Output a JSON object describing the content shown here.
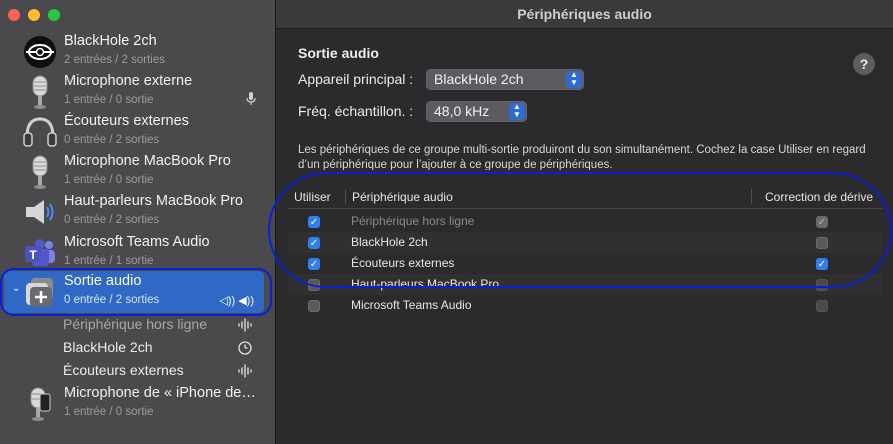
{
  "window": {
    "title": "Périphériques audio"
  },
  "sidebar": {
    "devices": [
      {
        "name": "BlackHole 2ch",
        "sub": "2 entrées / 2 sorties",
        "icon": "blackhole-icon"
      },
      {
        "name": "Microphone externe",
        "sub": "1 entrée / 0 sortie",
        "icon": "microphone-icon",
        "badge": "microphone-badge-icon"
      },
      {
        "name": "Écouteurs externes",
        "sub": "0 entrée / 2 sorties",
        "icon": "headphones-icon"
      },
      {
        "name": "Microphone MacBook Pro",
        "sub": "1 entrée / 0 sortie",
        "icon": "microphone-icon"
      },
      {
        "name": "Haut-parleurs MacBook Pro",
        "sub": "0 entrée / 2 sorties",
        "icon": "speaker-icon"
      },
      {
        "name": "Microsoft Teams Audio",
        "sub": "1 entrée / 1 sortie",
        "icon": "teams-icon"
      },
      {
        "name": "Sortie audio",
        "sub": "0 entrée / 2 sorties",
        "icon": "multi-output-icon",
        "selected": true,
        "right": "◁)) ◀))"
      },
      {
        "name": "Microphone de « iPhone de…",
        "sub": "1 entrée / 0 sortie",
        "icon": "iphone-mic-icon"
      }
    ],
    "subdevices": [
      {
        "label": "Périphérique hors ligne",
        "icon": "waveform-icon"
      },
      {
        "label": "BlackHole 2ch",
        "icon": "clock-icon"
      },
      {
        "label": "Écouteurs externes",
        "icon": "waveform-icon"
      }
    ]
  },
  "main": {
    "section_title": "Sortie audio",
    "help": "?",
    "primary_label": "Appareil principal :",
    "primary_value": "BlackHole 2ch",
    "rate_label": "Fréq. échantillon. :",
    "rate_value": "48,0 kHz",
    "description": "Les périphériques de ce groupe multi-sortie produiront du son simultanément. Cochez la case Utiliser en regard d’un périphérique pour l’ajouter à ce groupe de périphériques.",
    "table": {
      "headers": {
        "use": "Utiliser",
        "device": "Périphérique audio",
        "drift": "Correction de dérive"
      },
      "rows": [
        {
          "name": "Périphérique hors ligne",
          "use": true,
          "drift": true,
          "dim": true
        },
        {
          "name": "BlackHole 2ch",
          "use": true,
          "drift": false
        },
        {
          "name": "Écouteurs externes",
          "use": true,
          "drift": true
        },
        {
          "name": "Haut-parleurs MacBook Pro",
          "use": false,
          "drift": false
        },
        {
          "name": "Microsoft Teams Audio",
          "use": false,
          "drift": false
        }
      ]
    }
  },
  "colors": {
    "accent": "#2f69c5",
    "checkbox": "#2f7ff0",
    "annotation": "#0a1fd6"
  }
}
